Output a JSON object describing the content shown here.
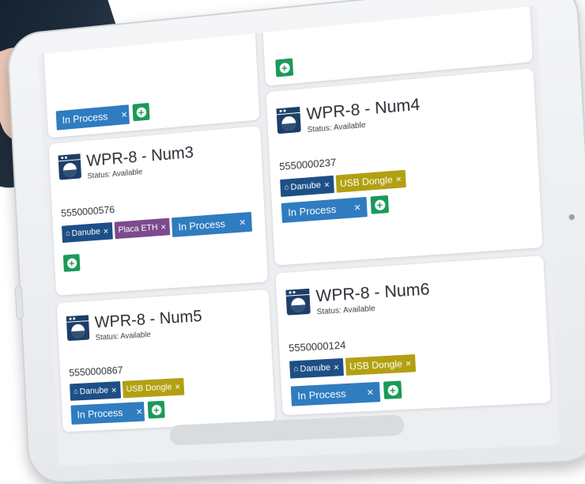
{
  "colors": {
    "navy": "#1d4f86",
    "purple": "#7d4a8e",
    "olive": "#b2a012",
    "process_blue": "#2f7cc0",
    "green": "#1a9a58"
  },
  "top_left_card": {
    "process_label": "In Process",
    "remove": "×"
  },
  "cards": [
    {
      "title": "WPR-8 - Num3",
      "status": "Status: Available",
      "phone": "5550000576",
      "tags": [
        {
          "label": "Danube",
          "remove": "×",
          "icon": "home-icon"
        },
        {
          "label": "Placa ETH",
          "remove": "×"
        },
        {
          "label": "In Process",
          "remove": "×"
        }
      ]
    },
    {
      "title": "WPR-8 - Num4",
      "status": "Status: Available",
      "phone": "5550000237",
      "tags": [
        {
          "label": "Danube",
          "remove": "×",
          "icon": "home-icon"
        },
        {
          "label": "USB Dongle",
          "remove": "×"
        },
        {
          "label": "In Process",
          "remove": "×"
        }
      ]
    },
    {
      "title": "WPR-8 - Num5",
      "status": "Status: Available",
      "phone": "5550000867",
      "tags": [
        {
          "label": "Danube",
          "remove": "×",
          "icon": "home-icon"
        },
        {
          "label": "USB Dongle",
          "remove": "×"
        },
        {
          "label": "In Process",
          "remove": "×"
        }
      ]
    },
    {
      "title": "WPR-8 - Num6",
      "status": "Status: Available",
      "phone": "5550000124",
      "tags": [
        {
          "label": "Danube",
          "remove": "×",
          "icon": "home-icon"
        },
        {
          "label": "USB Dongle",
          "remove": "×"
        },
        {
          "label": "In Process",
          "remove": "×"
        }
      ]
    }
  ]
}
